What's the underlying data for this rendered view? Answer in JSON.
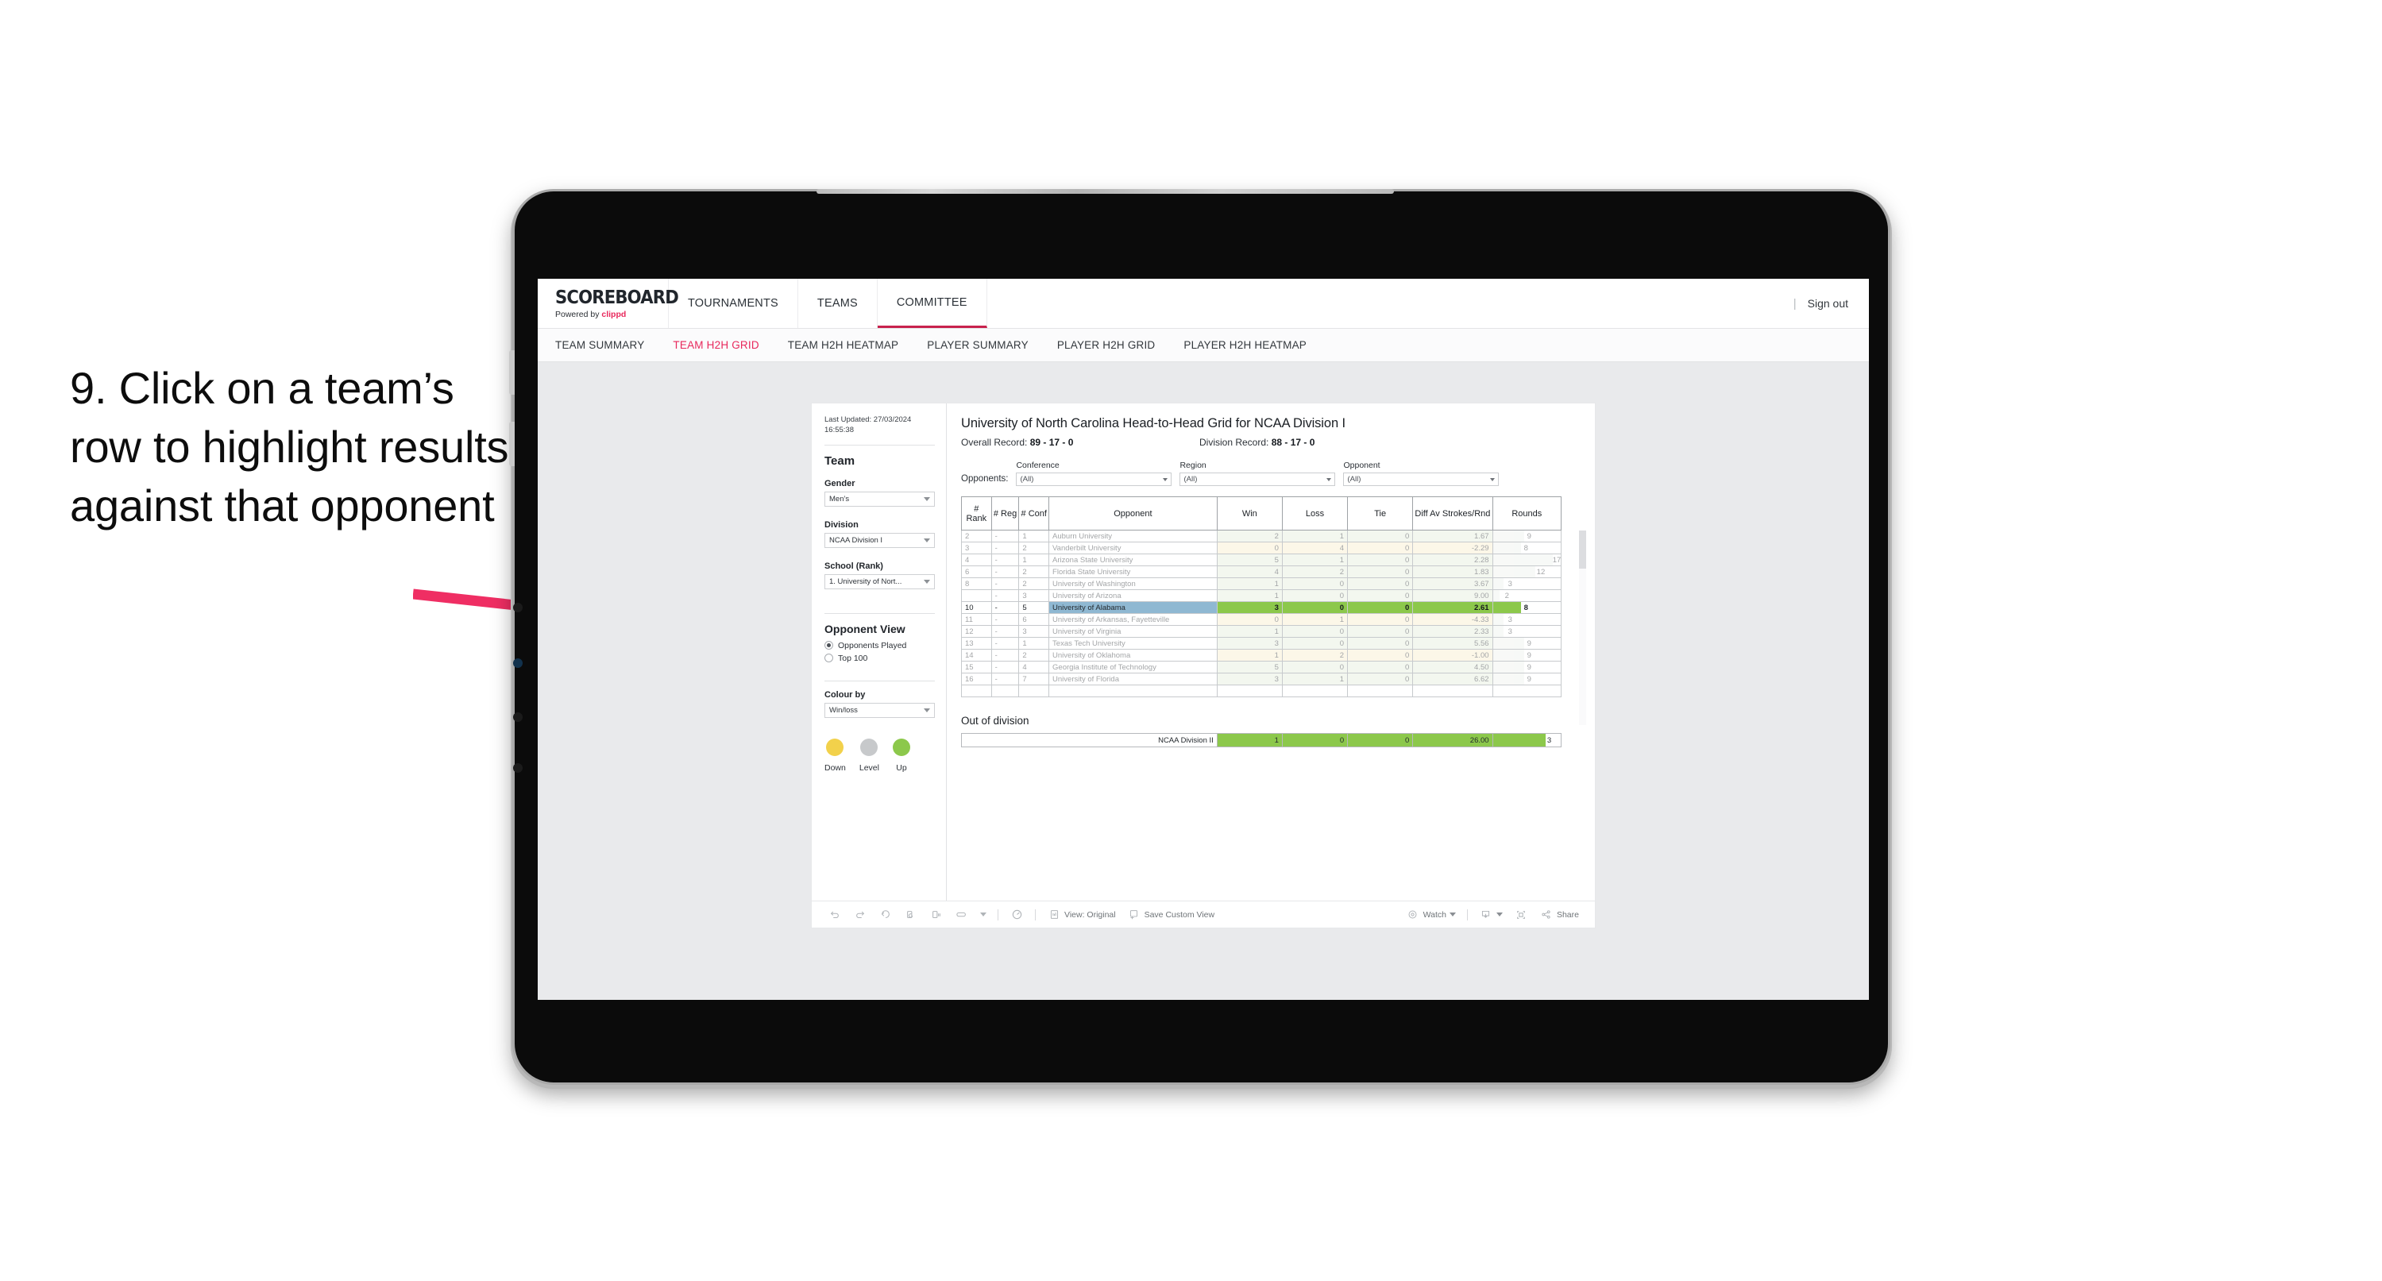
{
  "caption": "9. Click on a team’s row to highlight results against that opponent",
  "brand": {
    "name": "SCOREBOARD",
    "powered_prefix": "Powered by ",
    "powered_by": "clippd"
  },
  "topnav": {
    "items": [
      {
        "label": "TOURNAMENTS",
        "active": false
      },
      {
        "label": "TEAMS",
        "active": false
      },
      {
        "label": "COMMITTEE",
        "active": true
      }
    ],
    "divider": "|",
    "sign_out": "Sign out"
  },
  "subnav": {
    "items": [
      {
        "label": "TEAM SUMMARY",
        "active": false
      },
      {
        "label": "TEAM H2H GRID",
        "active": true
      },
      {
        "label": "TEAM H2H HEATMAP",
        "active": false
      },
      {
        "label": "PLAYER SUMMARY",
        "active": false
      },
      {
        "label": "PLAYER H2H GRID",
        "active": false
      },
      {
        "label": "PLAYER H2H HEATMAP",
        "active": false
      }
    ]
  },
  "panel": {
    "last_updated": "Last Updated: 27/03/2024 16:55:38",
    "team_heading": "Team",
    "gender": {
      "label": "Gender",
      "value": "Men’s"
    },
    "division": {
      "label": "Division",
      "value": "NCAA Division I"
    },
    "school": {
      "label": "School (Rank)",
      "value": "1. University of Nort..."
    },
    "opponent_view": {
      "heading": "Opponent View",
      "options": [
        {
          "label": "Opponents Played",
          "selected": true
        },
        {
          "label": "Top 100",
          "selected": false
        }
      ]
    },
    "colour_by": {
      "label": "Colour by",
      "value": "Win/loss"
    },
    "legend": [
      {
        "label": "Down",
        "color": "#f2d14b"
      },
      {
        "label": "Level",
        "color": "#c7c9cb"
      },
      {
        "label": "Up",
        "color": "#8cc84b"
      }
    ]
  },
  "viz": {
    "title": "University of North Carolina Head-to-Head Grid for NCAA Division I",
    "overall_record_label": "Overall Record: ",
    "overall_record_value": "89 - 17 - 0",
    "division_record_label": "Division Record: ",
    "division_record_value": "88 - 17 - 0",
    "filters": {
      "lead": "Opponents:",
      "fields": [
        {
          "label": "Conference",
          "value": "(All)"
        },
        {
          "label": "Region",
          "value": "(All)"
        },
        {
          "label": "Opponent",
          "value": "(All)"
        }
      ]
    },
    "columns": [
      "# Rank",
      "# Reg",
      "# Conf",
      "Opponent",
      "Win",
      "Loss",
      "Tie",
      "Diff Av Strokes/Rnd",
      "Rounds"
    ],
    "rows": [
      {
        "rank": "2",
        "reg": "-",
        "conf": "1",
        "opponent": "Auburn University",
        "win": "2",
        "loss": "1",
        "tie": "0",
        "diff": "1.67",
        "rounds": "9",
        "result": "up",
        "selected": false
      },
      {
        "rank": "3",
        "reg": "-",
        "conf": "2",
        "opponent": "Vanderbilt University",
        "win": "0",
        "loss": "4",
        "tie": "0",
        "diff": "-2.29",
        "rounds": "8",
        "result": "down",
        "selected": false
      },
      {
        "rank": "4",
        "reg": "-",
        "conf": "1",
        "opponent": "Arizona State University",
        "win": "5",
        "loss": "1",
        "tie": "0",
        "diff": "2.28",
        "rounds": "17",
        "result": "up",
        "selected": false
      },
      {
        "rank": "6",
        "reg": "-",
        "conf": "2",
        "opponent": "Florida State University",
        "win": "4",
        "loss": "2",
        "tie": "0",
        "diff": "1.83",
        "rounds": "12",
        "result": "up",
        "selected": false
      },
      {
        "rank": "8",
        "reg": "-",
        "conf": "2",
        "opponent": "University of Washington",
        "win": "1",
        "loss": "0",
        "tie": "0",
        "diff": "3.67",
        "rounds": "3",
        "result": "up",
        "selected": false
      },
      {
        "rank": "",
        "reg": "-",
        "conf": "3",
        "opponent": "University of Arizona",
        "win": "1",
        "loss": "0",
        "tie": "0",
        "diff": "9.00",
        "rounds": "2",
        "result": "up",
        "selected": false
      },
      {
        "rank": "10",
        "reg": "-",
        "conf": "5",
        "opponent": "University of Alabama",
        "win": "3",
        "loss": "0",
        "tie": "0",
        "diff": "2.61",
        "rounds": "8",
        "result": "up",
        "selected": true
      },
      {
        "rank": "11",
        "reg": "-",
        "conf": "6",
        "opponent": "University of Arkansas, Fayetteville",
        "win": "0",
        "loss": "1",
        "tie": "0",
        "diff": "-4.33",
        "rounds": "3",
        "result": "down",
        "selected": false
      },
      {
        "rank": "12",
        "reg": "-",
        "conf": "3",
        "opponent": "University of Virginia",
        "win": "1",
        "loss": "0",
        "tie": "0",
        "diff": "2.33",
        "rounds": "3",
        "result": "up",
        "selected": false
      },
      {
        "rank": "13",
        "reg": "-",
        "conf": "1",
        "opponent": "Texas Tech University",
        "win": "3",
        "loss": "0",
        "tie": "0",
        "diff": "5.56",
        "rounds": "9",
        "result": "up",
        "selected": false
      },
      {
        "rank": "14",
        "reg": "-",
        "conf": "2",
        "opponent": "University of Oklahoma",
        "win": "1",
        "loss": "2",
        "tie": "0",
        "diff": "-1.00",
        "rounds": "9",
        "result": "down",
        "selected": false
      },
      {
        "rank": "15",
        "reg": "-",
        "conf": "4",
        "opponent": "Georgia Institute of Technology",
        "win": "5",
        "loss": "0",
        "tie": "0",
        "diff": "4.50",
        "rounds": "9",
        "result": "up",
        "selected": false
      },
      {
        "rank": "16",
        "reg": "-",
        "conf": "7",
        "opponent": "University of Florida",
        "win": "3",
        "loss": "1",
        "tie": "0",
        "diff": "6.62",
        "rounds": "9",
        "result": "up",
        "selected": false
      }
    ],
    "out_of_division": {
      "title": "Out of division",
      "row": {
        "label": "NCAA Division II",
        "win": "1",
        "loss": "0",
        "tie": "0",
        "diff": "26.00",
        "rounds": "3"
      }
    }
  },
  "toolbar": {
    "view_label": "View: Original",
    "save_label": "Save Custom View",
    "watch_label": "Watch",
    "share_label": "Share"
  },
  "colors": {
    "accent": "#e8285c",
    "up_fill": "#e3edda",
    "down_fill": "#faeeca",
    "selected_green": "#8cc84b",
    "selected_blue": "#8fb8d2",
    "rounds_bar": "#eef1ed"
  }
}
